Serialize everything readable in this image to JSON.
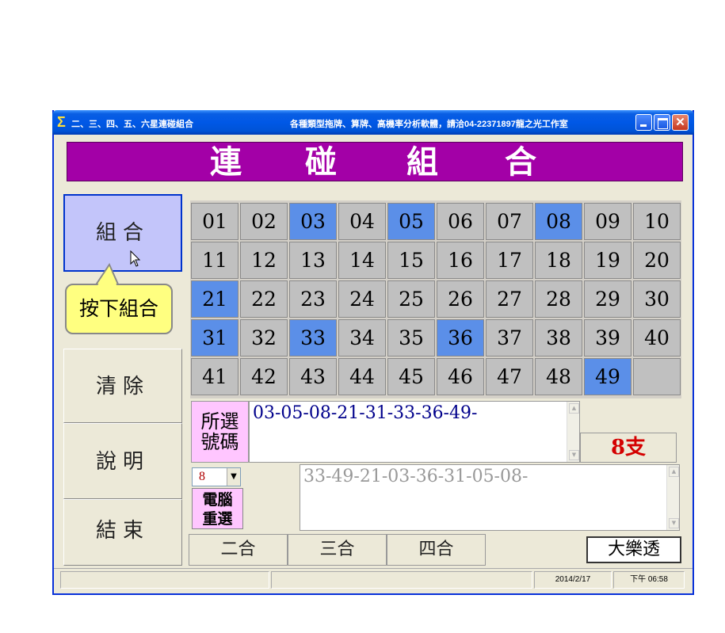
{
  "window": {
    "title": "二、三、四、五、六星連碰組合",
    "ad_text": "各種類型拖牌、算牌、高機率分析軟體，請洽04-22371897龍之光工作室"
  },
  "banner": {
    "chars": [
      "連",
      "碰",
      "組",
      "合"
    ]
  },
  "left_buttons": {
    "combine": "組合",
    "clear": "清除",
    "help": "說明",
    "exit": "結束"
  },
  "tooltip": "按下組合",
  "grid": {
    "numbers": [
      "01",
      "02",
      "03",
      "04",
      "05",
      "06",
      "07",
      "08",
      "09",
      "10",
      "11",
      "12",
      "13",
      "14",
      "15",
      "16",
      "17",
      "18",
      "19",
      "20",
      "21",
      "22",
      "23",
      "24",
      "25",
      "26",
      "27",
      "28",
      "29",
      "30",
      "31",
      "32",
      "33",
      "34",
      "35",
      "36",
      "37",
      "38",
      "39",
      "40",
      "41",
      "42",
      "43",
      "44",
      "45",
      "46",
      "47",
      "48",
      "49"
    ],
    "selected": [
      "03",
      "05",
      "08",
      "21",
      "31",
      "33",
      "36",
      "49"
    ]
  },
  "selection": {
    "label_line1": "所選",
    "label_line2": "號碼",
    "value": "03-05-08-21-31-33-36-49-",
    "count": "8支"
  },
  "random": {
    "select_value": "8",
    "button_line1": "電腦",
    "button_line2": "重選",
    "value": "33-49-21-03-36-31-05-08-"
  },
  "tabs": [
    "二合",
    "三合",
    "四合"
  ],
  "lotto_button": "大樂透",
  "statusbar": {
    "date": "2014/2/17",
    "time": "下午 06:58"
  },
  "colors": {
    "selected": "#5b8fe8",
    "banner": "#a300a7",
    "label_pink": "#ffc6ff"
  }
}
